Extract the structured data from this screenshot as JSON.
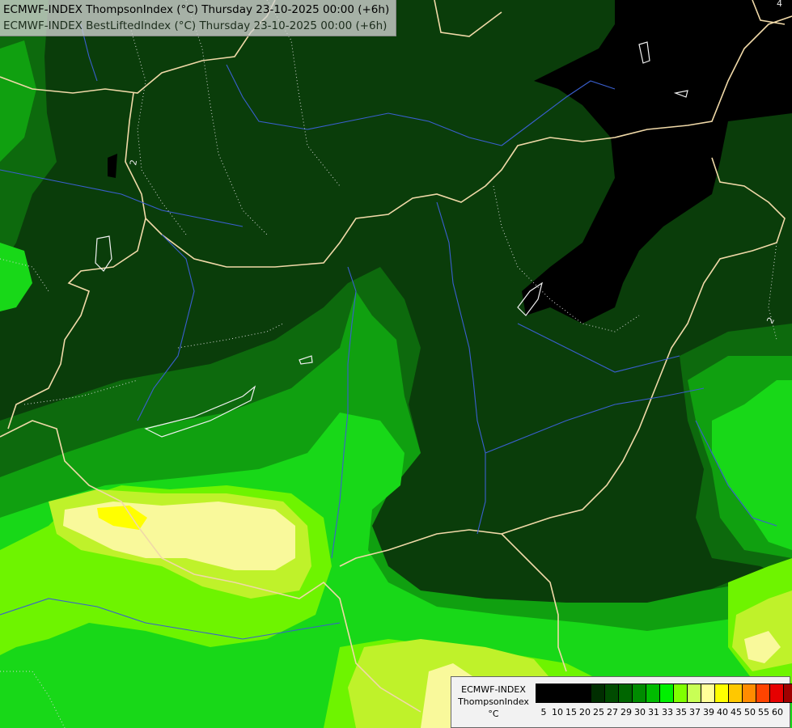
{
  "title": {
    "line1": "ECMWF-INDEX ThompsonIndex (°C) Thursday 23-10-2025 00:00 (+6h)",
    "line2": "ECMWF-INDEX BestLiftedIndex (°C) Thursday 23-10-2025 00:00 (+6h)"
  },
  "contour_labels": [
    "2",
    "2",
    "4"
  ],
  "legend": {
    "model": "ECMWF-INDEX",
    "parameter": "ThompsonIndex",
    "unit": "°C",
    "ticks": [
      "5",
      "10",
      "15",
      "20",
      "25",
      "27",
      "29",
      "30",
      "31",
      "33",
      "35",
      "37",
      "39",
      "40",
      "45",
      "50",
      "55",
      "60"
    ],
    "colors": [
      "#000000",
      "#002e00",
      "#004b00",
      "#006600",
      "#008b00",
      "#00bb00",
      "#00f000",
      "#80ff00",
      "#c8ff55",
      "#ffff99",
      "#ffff00",
      "#ffc800",
      "#ff8c00",
      "#ff4400",
      "#e60000",
      "#a00000",
      "#ff00ff",
      "#c800ff",
      "#8c00ff",
      "#4b00ff",
      "#0000ff"
    ]
  },
  "map_colors": {
    "black": "#000000",
    "dark_green": "#0a3d0a",
    "mid_green": "#0d6a0d",
    "green": "#10a010",
    "bright_green": "#18d818",
    "lime": "#6ef400",
    "yellow_green": "#bff22a",
    "pale_yellow": "#f9f99b",
    "yellow": "#ffff00",
    "border": "#f0d9a8",
    "river": "#3a5fcf",
    "isoline": "#d8d8d8"
  }
}
